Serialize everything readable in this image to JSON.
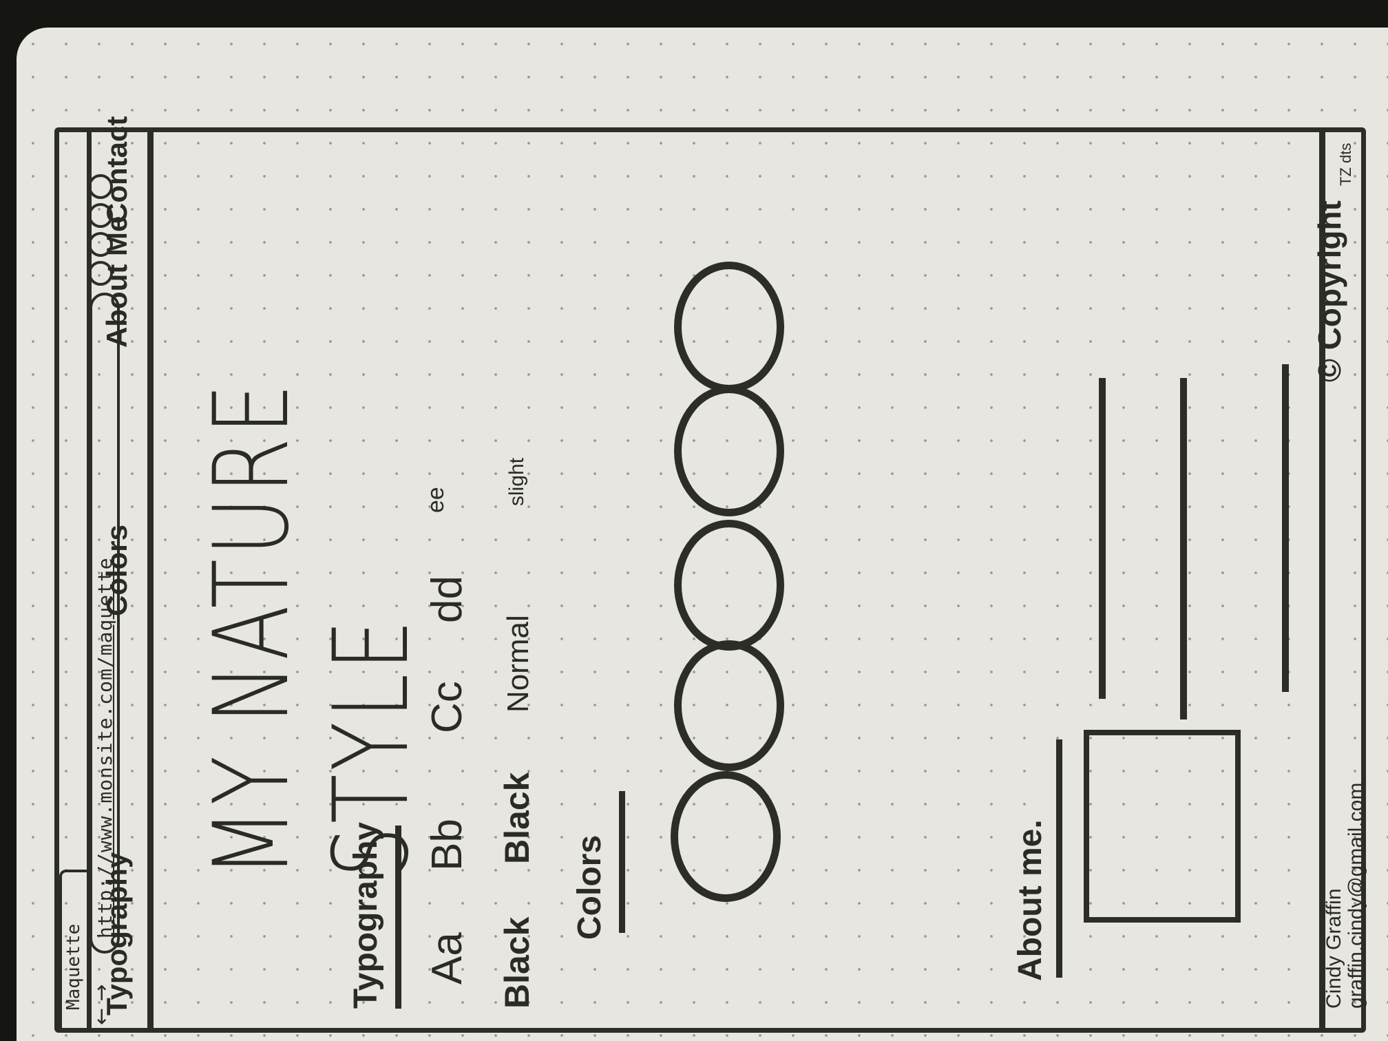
{
  "browser": {
    "tab_title": "Maquette",
    "nav_arrows": "← →",
    "url": "http://www.monsite.com/maquette"
  },
  "nav": {
    "typography": "Typography",
    "colors": "Colors",
    "about": "About Me",
    "contact": "Contact"
  },
  "hero_title": "MY NATURE STYLE",
  "typography": {
    "heading": "Typography",
    "glyphs": [
      "Aa",
      "Bb",
      "Cc",
      "dd",
      "ee"
    ],
    "weights": [
      "Black",
      "Black",
      "Normal",
      "slight"
    ]
  },
  "colors": {
    "heading": "Colors",
    "swatch_count": 5
  },
  "about": {
    "heading": "About me."
  },
  "footer": {
    "name": "Cindy Graffin",
    "email": "graffin.cindy@gmail.com",
    "copyright": "© Copyright",
    "copyright_note": "TZ dts"
  }
}
